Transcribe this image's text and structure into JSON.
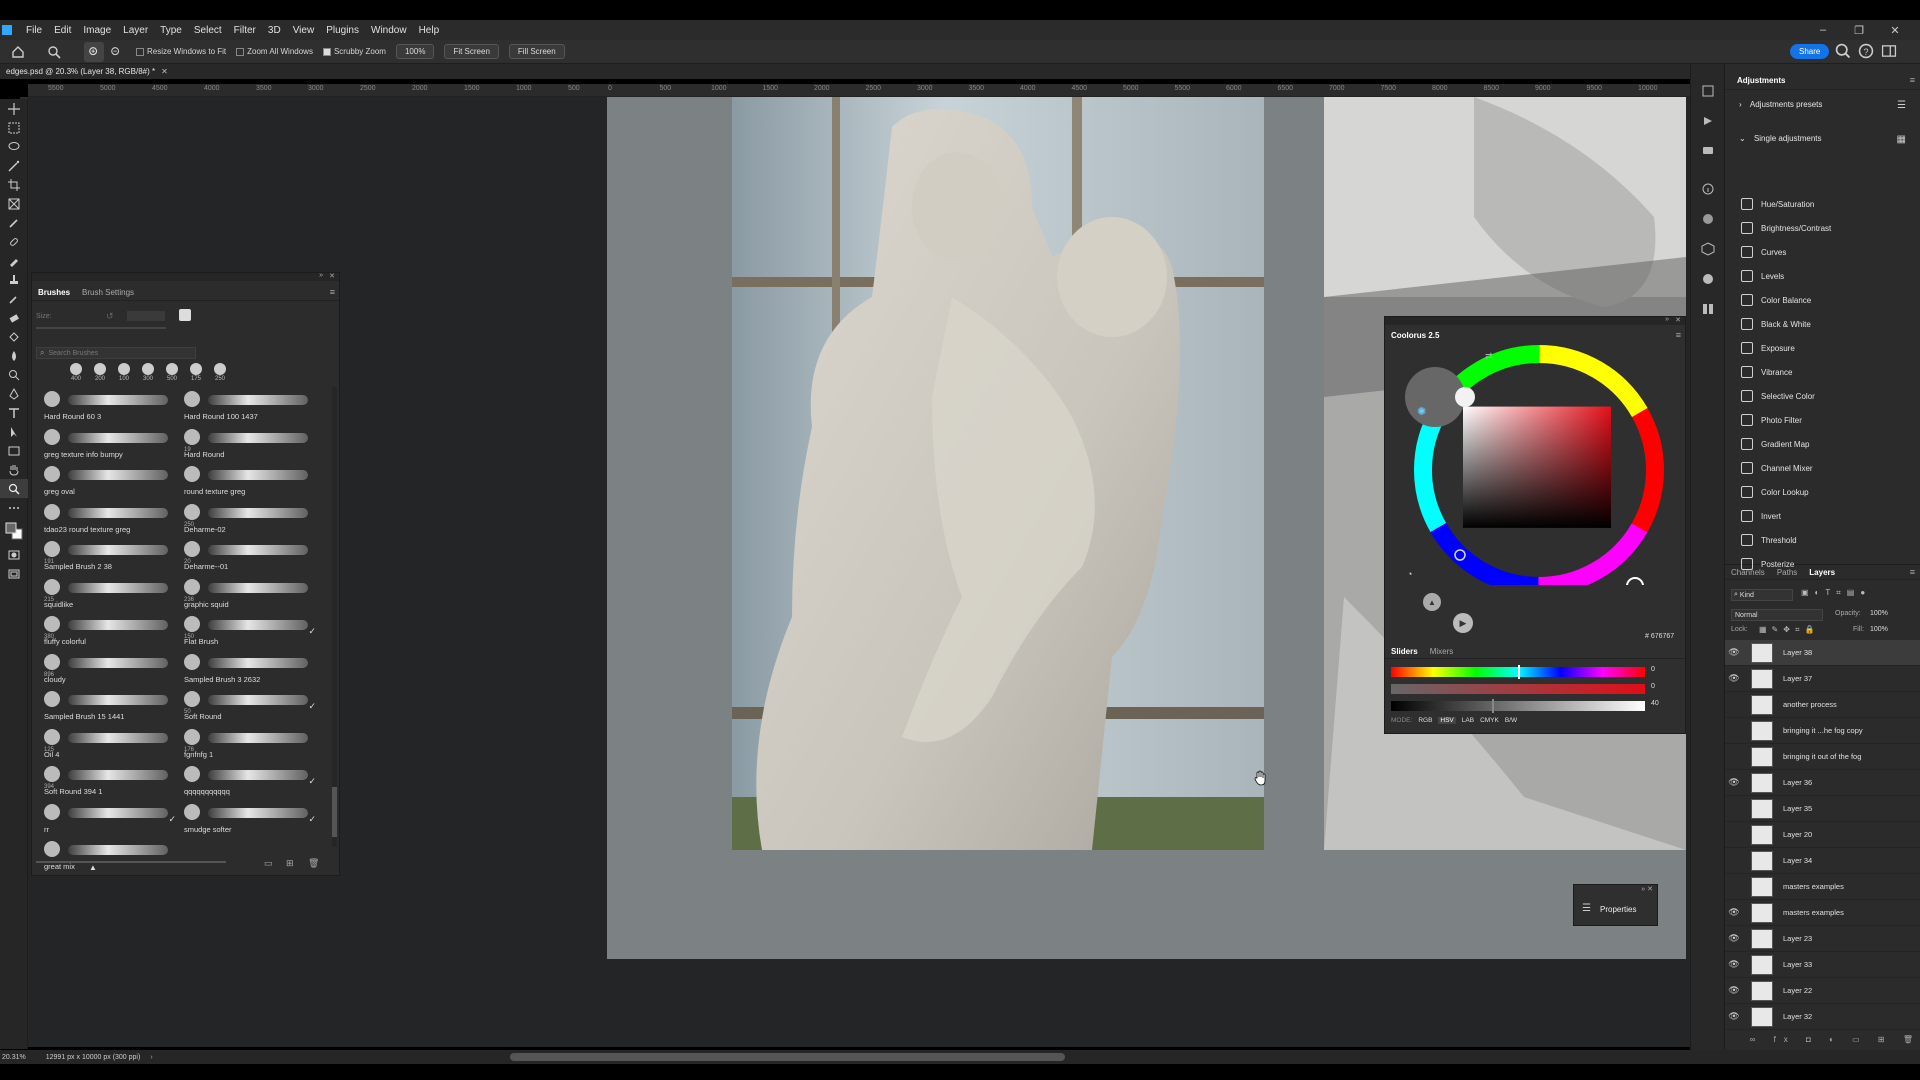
{
  "menubar": {
    "items": [
      "File",
      "Edit",
      "Image",
      "Layer",
      "Type",
      "Select",
      "Filter",
      "3D",
      "View",
      "Plugins",
      "Window",
      "Help"
    ]
  },
  "options": {
    "resize_windows": "Resize Windows to Fit",
    "zoom_all": "Zoom All Windows",
    "scrubby_zoom": "Scrubby Zoom",
    "zoom_percent": "100%",
    "fit_screen": "Fit Screen",
    "fill_screen": "Fill Screen",
    "share": "Share"
  },
  "document": {
    "tab_title": "edges.psd @ 20.3% (Layer 38, RGB/8#) *"
  },
  "rulers": {
    "top_left": [
      "5500",
      "5000",
      "4500",
      "4000",
      "3500",
      "3000",
      "2500",
      "2000",
      "1500",
      "1000",
      "500"
    ],
    "top_right": [
      "0",
      "500",
      "1000",
      "1500",
      "2000",
      "2500",
      "3000",
      "3500",
      "4000",
      "4500",
      "5000",
      "5500",
      "6000",
      "6500",
      "7000",
      "7500",
      "8000",
      "8500",
      "9000",
      "9500",
      "10000"
    ]
  },
  "brushes": {
    "tab_brushes": "Brushes",
    "tab_settings": "Brush Settings",
    "size_label": "Size:",
    "search_placeholder": "Search Brushes",
    "presets": [
      "400",
      "200",
      "100",
      "300",
      "500",
      "175",
      "250"
    ],
    "list": [
      {
        "name": "Hard Round 60 3",
        "num": ""
      },
      {
        "name": "Hard Round 100 1437",
        "num": ""
      },
      {
        "name": "greg texture info bumpy",
        "num": ""
      },
      {
        "name": "Hard Round",
        "num": "19"
      },
      {
        "name": "greg oval",
        "num": ""
      },
      {
        "name": "round texture greg",
        "num": ""
      },
      {
        "name": "tdao23 round texture greg",
        "num": ""
      },
      {
        "name": "Deharme-02",
        "num": "250"
      },
      {
        "name": "Sampled Brush 2 38",
        "num": "191"
      },
      {
        "name": "Deharme--01",
        "num": "20"
      },
      {
        "name": "squidlike",
        "num": "215"
      },
      {
        "name": "graphic squid",
        "num": "236"
      },
      {
        "name": "fluffy colorful",
        "num": "380"
      },
      {
        "name": "Flat Brush",
        "num": "150"
      },
      {
        "name": "cloudy",
        "num": "896"
      },
      {
        "name": "Sampled Brush 3 2632",
        "num": ""
      },
      {
        "name": "Sampled Brush 15 1441",
        "num": ""
      },
      {
        "name": "Soft Round",
        "num": "50"
      },
      {
        "name": "Oil 4",
        "num": "125"
      },
      {
        "name": "fgnfnfg 1",
        "num": "176"
      },
      {
        "name": "Soft Round 394 1",
        "num": "394"
      },
      {
        "name": "qqqqqqqqqqq",
        "num": ""
      },
      {
        "name": "rr",
        "num": ""
      },
      {
        "name": "smudge softer",
        "num": ""
      },
      {
        "name": "great mix",
        "num": ""
      }
    ]
  },
  "coolorus": {
    "title": "Coolorus 2.5",
    "hex": "# 676767",
    "tab_sliders": "Sliders",
    "tab_mixers": "Mixers",
    "slider_values": [
      "0",
      "0",
      "40"
    ],
    "mode_label": "MODE:",
    "modes": [
      "RGB",
      "HSV",
      "LAB",
      "CMYK",
      "B/W"
    ]
  },
  "adjustments": {
    "title": "Adjustments",
    "presets": "Adjustments presets",
    "single": "Single adjustments",
    "items": [
      "Hue/Saturation",
      "Brightness/Contrast",
      "Curves",
      "Levels",
      "Color Balance",
      "Black & White",
      "Exposure",
      "Vibrance",
      "Selective Color",
      "Photo Filter",
      "Gradient Map",
      "Channel Mixer",
      "Color Lookup",
      "Invert",
      "Threshold",
      "Posterize"
    ]
  },
  "layers": {
    "tabs": [
      "Channels",
      "Paths",
      "Layers"
    ],
    "kind": "Kind",
    "blend": "Normal",
    "opacity_label": "Opacity:",
    "opacity": "100%",
    "lock_label": "Lock:",
    "fill_label": "Fill:",
    "fill": "100%",
    "list": [
      {
        "name": "Layer 38",
        "visible": true
      },
      {
        "name": "Layer 37",
        "visible": true
      },
      {
        "name": "another process",
        "visible": false
      },
      {
        "name": "bringing it ...he fog copy",
        "visible": false
      },
      {
        "name": "bringing it out of the fog",
        "visible": false
      },
      {
        "name": "Layer 36",
        "visible": true
      },
      {
        "name": "Layer 35",
        "visible": false
      },
      {
        "name": "Layer 20",
        "visible": false
      },
      {
        "name": "Layer 34",
        "visible": false
      },
      {
        "name": "masters examples",
        "visible": false
      },
      {
        "name": "masters examples",
        "visible": true
      },
      {
        "name": "Layer 23",
        "visible": true
      },
      {
        "name": "Layer 33",
        "visible": true
      },
      {
        "name": "Layer 22",
        "visible": true
      },
      {
        "name": "Layer 32",
        "visible": true
      }
    ]
  },
  "properties": {
    "label": "Properties"
  },
  "status": {
    "zoom": "20.31%",
    "size": "12991 px x 10000 px (300 ppi)"
  }
}
